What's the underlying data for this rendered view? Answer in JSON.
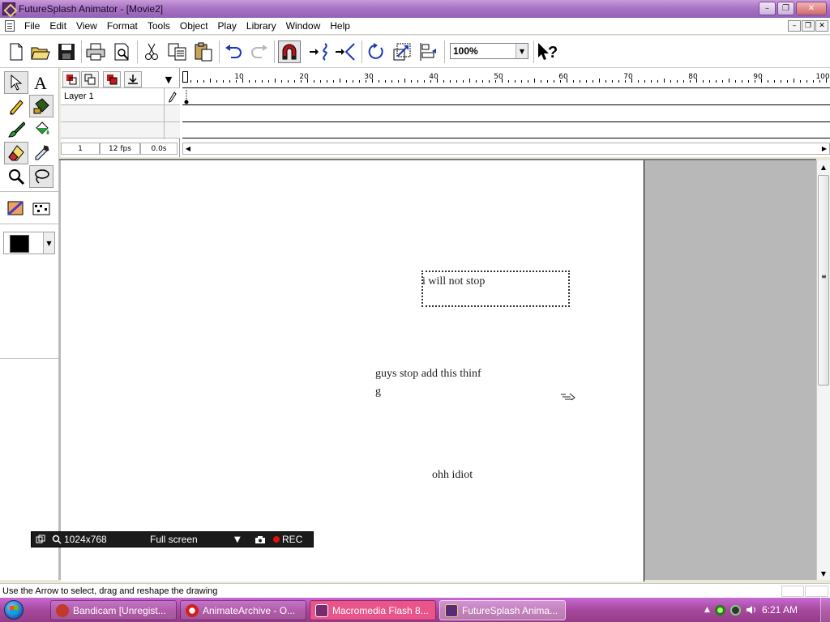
{
  "window": {
    "title": "FutureSplash Animator - [Movie2]",
    "controls": {
      "minimize": "–",
      "restore": "❐",
      "close": "✕"
    },
    "mdi_controls": {
      "minimize": "–",
      "restore": "❐",
      "close": "✕"
    }
  },
  "menu": [
    "File",
    "Edit",
    "View",
    "Format",
    "Tools",
    "Object",
    "Play",
    "Library",
    "Window",
    "Help"
  ],
  "toolbar": {
    "zoom": "100%",
    "zoom_arrow": "▼",
    "buttons": [
      "new-icon",
      "open-icon",
      "save-icon",
      "print-icon",
      "print-preview-icon",
      "cut-icon",
      "copy-icon",
      "paste-icon",
      "undo-icon",
      "redo-icon",
      "snap-magnet-icon",
      "smooth-icon",
      "straighten-icon",
      "rotate-icon",
      "scale-icon",
      "align-icon",
      "help-pointer-icon"
    ]
  },
  "timeline": {
    "layer_name": "Layer 1",
    "ruler_labels": [
      "10",
      "20",
      "30",
      "40",
      "50",
      "60",
      "70",
      "80",
      "90",
      "100"
    ],
    "frame": "1",
    "fps": "12 fps",
    "time": "0.0s",
    "scroll_left": "◀",
    "scroll_right": "▶"
  },
  "stage": {
    "texts": [
      "i will not stop",
      "guys stop add this thinf",
      "g",
      "ohh idiot"
    ]
  },
  "scroll": {
    "up": "▲",
    "down": "▼",
    "grip": "≡"
  },
  "fill": {
    "color": "#000000",
    "arrow": "▼"
  },
  "bandicam": {
    "size": "1024x768",
    "mode": "Full screen",
    "arrow": "▼",
    "rec": "REC"
  },
  "statusbar": {
    "message": "Use the Arrow to select, drag and reshape the drawing"
  },
  "taskbar": {
    "items": [
      {
        "label": "Bandicam [Unregist...",
        "color": "#c0392b"
      },
      {
        "label": "AnimateArchive - O...",
        "color": "#e0e0e0"
      },
      {
        "label": "Macromedia Flash 8...",
        "color": "#7a2a6e"
      },
      {
        "label": "FutureSplash Anima...",
        "color": "#5a2a7a"
      }
    ],
    "tray_arrow": "▲",
    "clock": "6:21 AM"
  }
}
